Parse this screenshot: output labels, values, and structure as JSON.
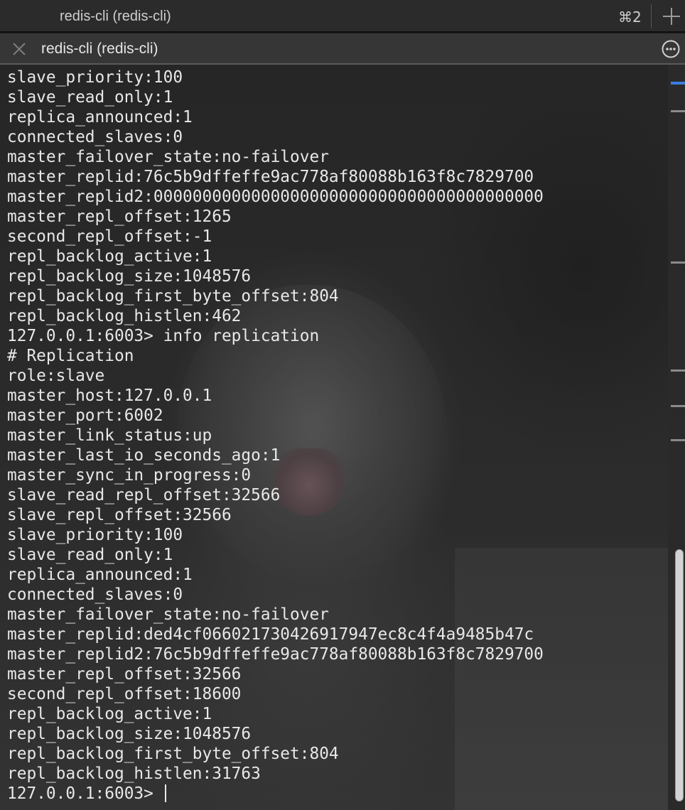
{
  "window": {
    "title": "redis-cli (redis-cli)",
    "shortcut": "⌘2"
  },
  "tab": {
    "title": "redis-cli (redis-cli)"
  },
  "icons": {
    "new_tab": "plus-icon",
    "close": "close-icon",
    "more": "ellipsis-circle-icon"
  },
  "colors": {
    "accent": "#3b7be0",
    "text": "#e8e8e8"
  },
  "terminal": {
    "lines": [
      "slave_priority:100",
      "slave_read_only:1",
      "replica_announced:1",
      "connected_slaves:0",
      "master_failover_state:no-failover",
      "master_replid:76c5b9dffeffe9ac778af80088b163f8c7829700",
      "master_replid2:0000000000000000000000000000000000000000",
      "master_repl_offset:1265",
      "second_repl_offset:-1",
      "repl_backlog_active:1",
      "repl_backlog_size:1048576",
      "repl_backlog_first_byte_offset:804",
      "repl_backlog_histlen:462",
      "127.0.0.1:6003> info replication",
      "# Replication",
      "role:slave",
      "master_host:127.0.0.1",
      "master_port:6002",
      "master_link_status:up",
      "master_last_io_seconds_ago:1",
      "master_sync_in_progress:0",
      "slave_read_repl_offset:32566",
      "slave_repl_offset:32566",
      "slave_priority:100",
      "slave_read_only:1",
      "replica_announced:1",
      "connected_slaves:0",
      "master_failover_state:no-failover",
      "master_replid:ded4cf06602173042691794 7ec8c4f4a9485b47c",
      "master_replid2:76c5b9dffeffe9ac778af80088b163f8c7829700",
      "master_repl_offset:32566",
      "second_repl_offset:18600",
      "repl_backlog_active:1",
      "repl_backlog_size:1048576",
      "repl_backlog_first_byte_offset:804",
      "repl_backlog_histlen:31763"
    ],
    "prompt": "127.0.0.1:6003> "
  }
}
